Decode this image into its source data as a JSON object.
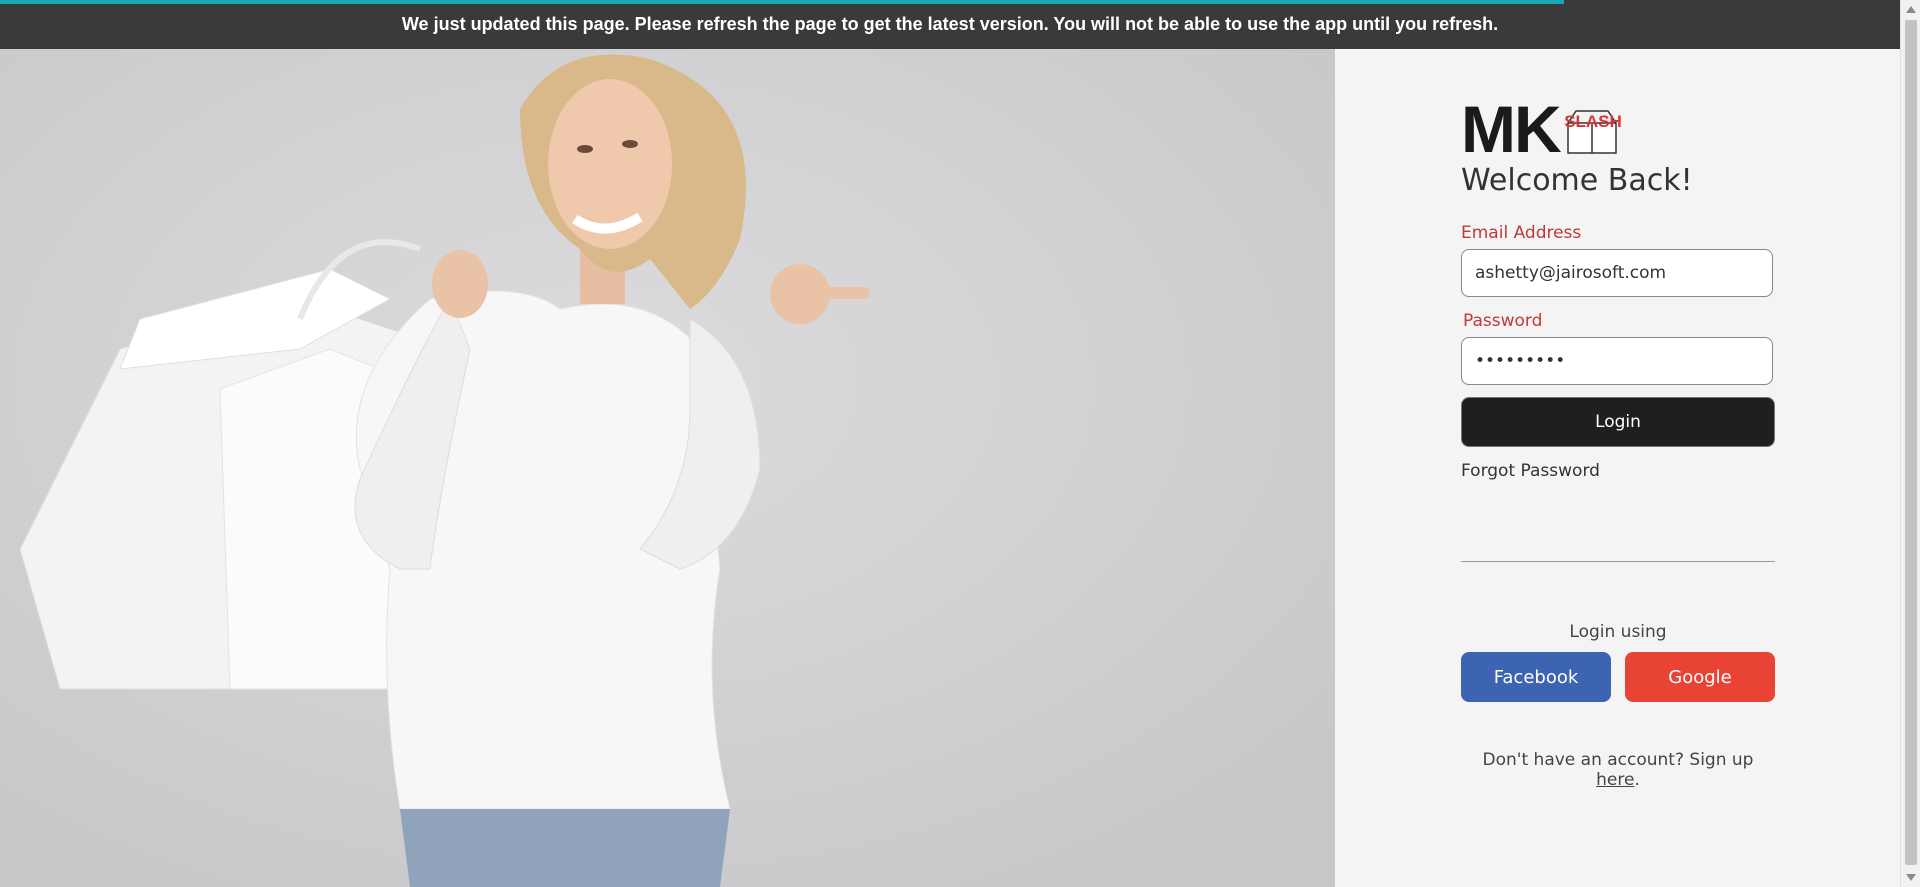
{
  "banner": {
    "message": "We just updated this page. Please refresh the page to get the latest version. You will not be able to use the app until you refresh."
  },
  "logo": {
    "text": "MK",
    "box_text": "SLASH"
  },
  "login": {
    "heading": "Welcome Back!",
    "email_label": "Email Address",
    "email_value": "ashetty@jairosoft.com",
    "password_label": "Password",
    "password_value": "•••••••••",
    "login_button": "Login",
    "forgot_link": "Forgot Password",
    "login_using": "Login using",
    "facebook_button": "Facebook",
    "google_button": "Google",
    "signup_prefix": "Don't have an account? Sign up ",
    "signup_link": "here",
    "signup_suffix": "."
  },
  "colors": {
    "accent_red": "#c0393b",
    "facebook": "#3d63b3",
    "google": "#e94336",
    "banner_bg": "#3a3a3a",
    "progress": "#19a6b5"
  },
  "icons": [
    "logo-box-icon"
  ]
}
